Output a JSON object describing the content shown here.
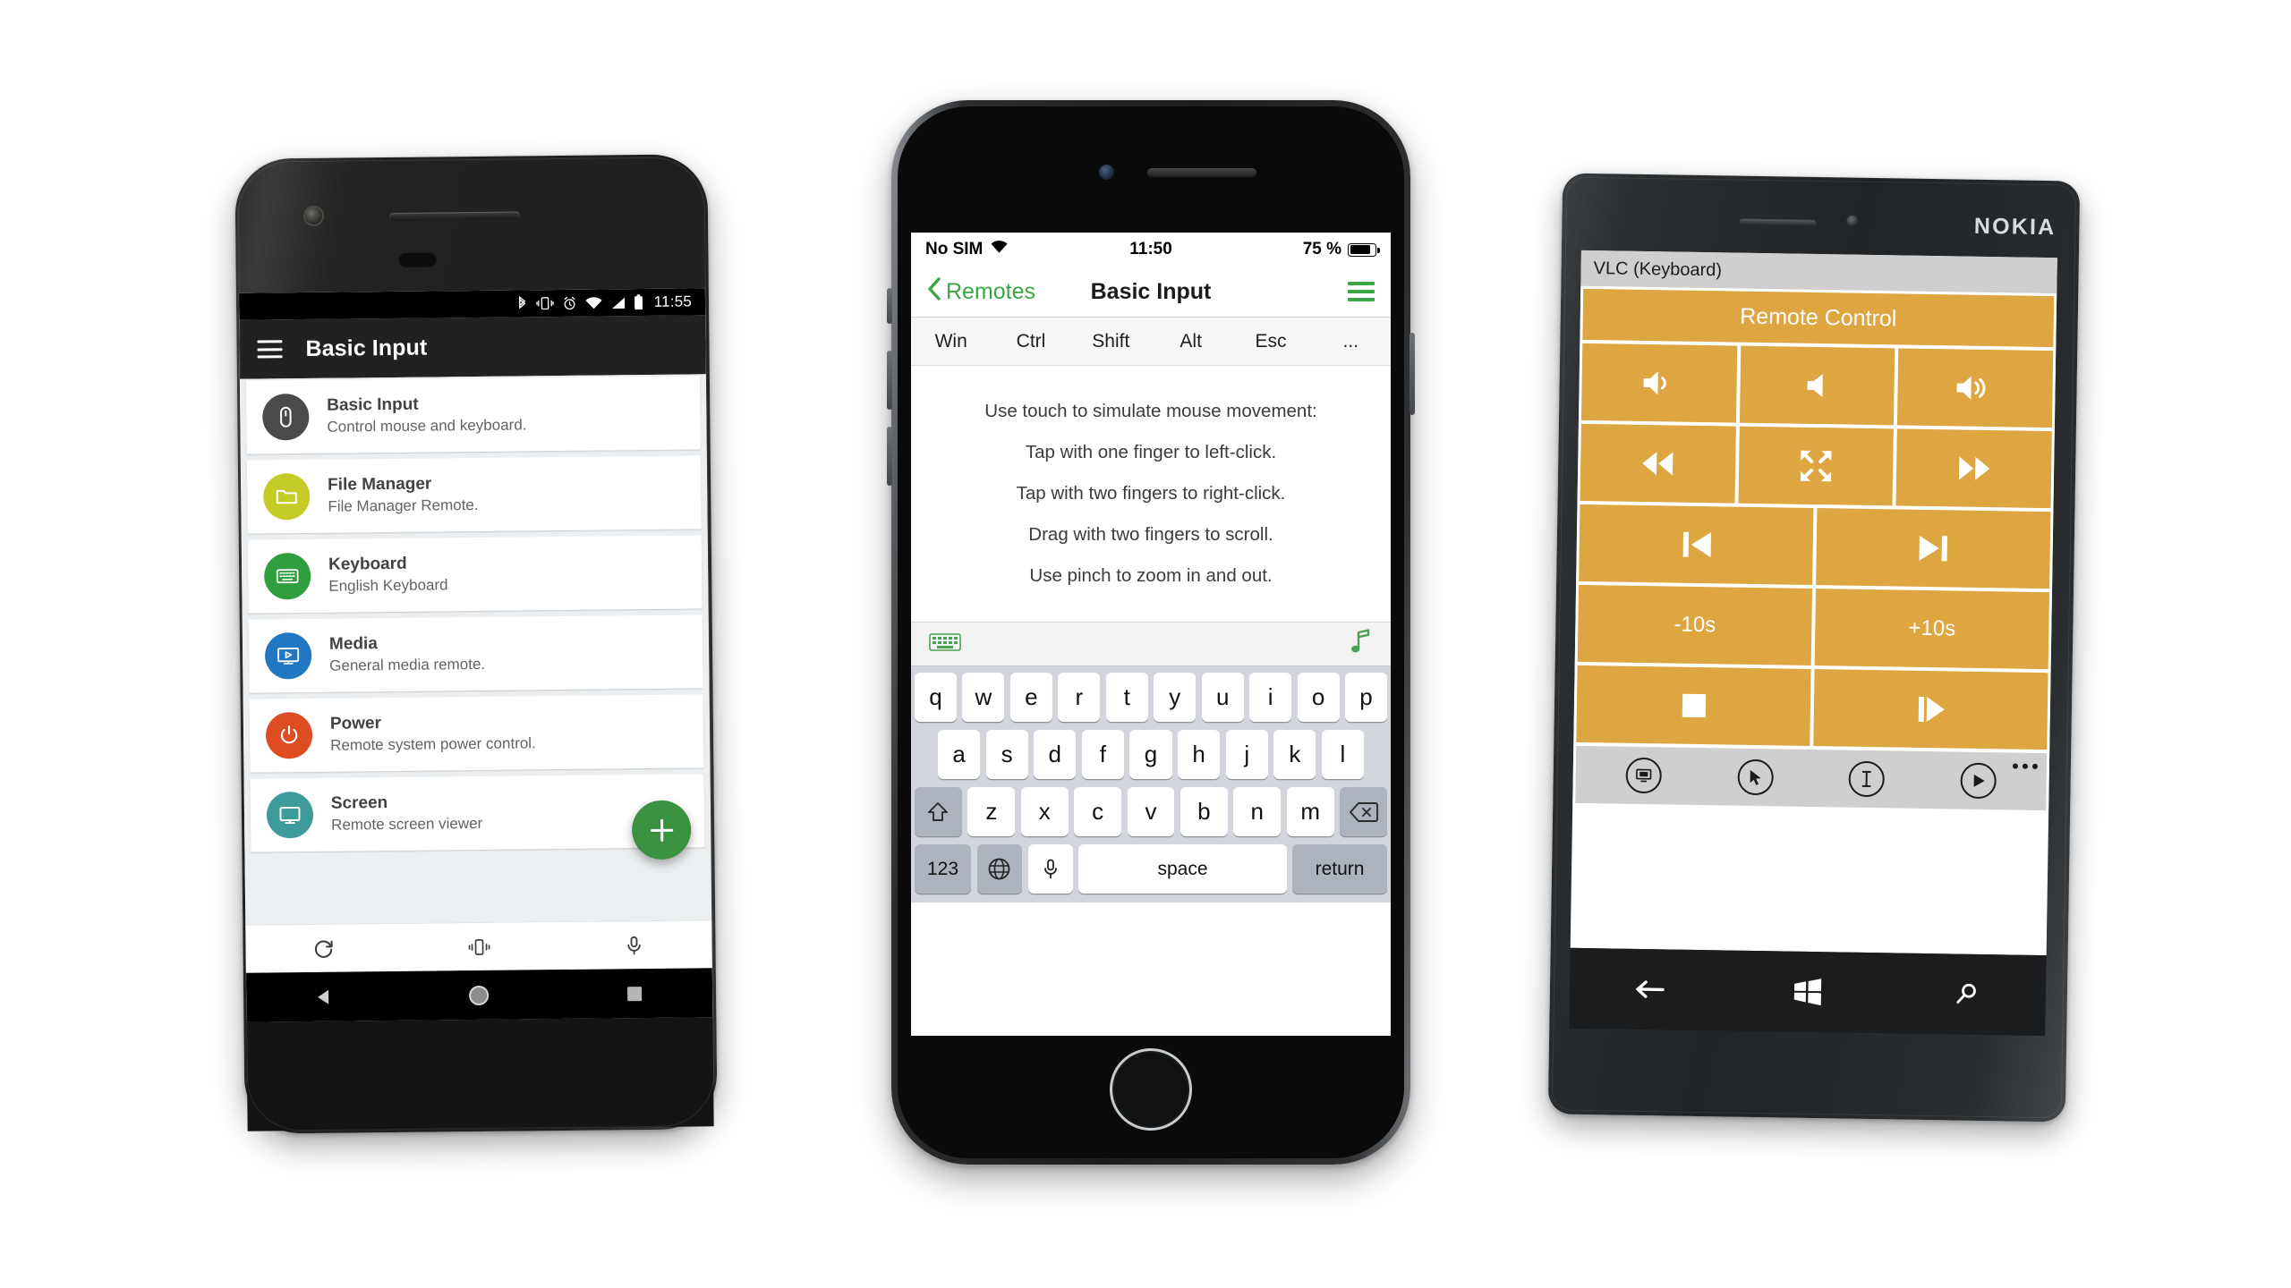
{
  "android": {
    "status_bar": {
      "icons": [
        "bluetooth-icon",
        "vibrate-icon",
        "alarm-icon",
        "wifi-icon",
        "signal-icon",
        "battery-icon"
      ],
      "time": "11:55"
    },
    "app_bar": {
      "menu_icon": "hamburger-menu-icon",
      "title": "Basic Input"
    },
    "list": [
      {
        "title": "Basic Input",
        "subtitle": "Control mouse and keyboard.",
        "icon": "mouse-icon",
        "color": "#4a4a4a"
      },
      {
        "title": "File Manager",
        "subtitle": "File Manager Remote.",
        "icon": "folder-icon",
        "color": "#c5cc28"
      },
      {
        "title": "Keyboard",
        "subtitle": "English Keyboard",
        "icon": "keyboard-icon",
        "color": "#2e9e3e"
      },
      {
        "title": "Media",
        "subtitle": "General media remote.",
        "icon": "media-screen-icon",
        "color": "#2277c2"
      },
      {
        "title": "Power",
        "subtitle": "Remote system power control.",
        "icon": "power-icon",
        "color": "#de4c22"
      },
      {
        "title": "Screen",
        "subtitle": "Remote screen viewer",
        "icon": "monitor-icon",
        "color": "#3e9b9b"
      }
    ],
    "fab": {
      "icon": "plus-icon",
      "color": "#3a913f"
    },
    "bottom_bar": [
      "refresh-icon",
      "vibrate-phone-icon",
      "microphone-icon"
    ],
    "nav_bar": [
      "back-triangle-icon",
      "home-circle-icon",
      "recents-square-icon"
    ]
  },
  "iphone": {
    "status_bar": {
      "carrier": "No SIM",
      "wifi_icon": "wifi-icon",
      "time": "11:50",
      "battery_pct": "75 %",
      "battery_icon": "battery-icon"
    },
    "nav_bar": {
      "back_label": "Remotes",
      "back_icon": "chevron-left-icon",
      "title": "Basic Input",
      "menu_icon": "hamburger-menu-icon",
      "accent": "#3aa745"
    },
    "modifier_keys": [
      "Win",
      "Ctrl",
      "Shift",
      "Alt",
      "Esc",
      "..."
    ],
    "instructions": [
      "Use touch to simulate mouse movement:",
      "Tap with one finger to left-click.",
      "Tap with two fingers to right-click.",
      "Drag with two fingers to scroll.",
      "Use pinch to zoom in and out."
    ],
    "accessory_bar": {
      "left_icon": "keyboard-icon",
      "right_icon": "music-note-icon"
    },
    "keyboard": {
      "row1": [
        "q",
        "w",
        "e",
        "r",
        "t",
        "y",
        "u",
        "i",
        "o",
        "p"
      ],
      "row2": [
        "a",
        "s",
        "d",
        "f",
        "g",
        "h",
        "j",
        "k",
        "l"
      ],
      "row3": [
        "z",
        "x",
        "c",
        "v",
        "b",
        "n",
        "m"
      ],
      "shift_icon": "shift-arrow-icon",
      "backspace_icon": "backspace-icon",
      "num_label": "123",
      "globe_icon": "globe-icon",
      "mic_icon": "microphone-icon",
      "space_label": "space",
      "return_label": "return"
    }
  },
  "nokia": {
    "brand": "NOKIA",
    "title_bar": "VLC (Keyboard)",
    "remote": {
      "header": "Remote Control",
      "accent": "#dda640",
      "buttons": [
        {
          "label": "",
          "icon": "volume-down-icon",
          "span": "third"
        },
        {
          "label": "",
          "icon": "volume-mute-icon",
          "span": "third"
        },
        {
          "label": "",
          "icon": "volume-up-icon",
          "span": "third"
        },
        {
          "label": "",
          "icon": "rewind-icon",
          "span": "third"
        },
        {
          "label": "",
          "icon": "fullscreen-icon",
          "span": "third"
        },
        {
          "label": "",
          "icon": "fast-forward-icon",
          "span": "third"
        },
        {
          "label": "",
          "icon": "previous-track-icon",
          "span": "half"
        },
        {
          "label": "",
          "icon": "next-track-icon",
          "span": "half"
        },
        {
          "label": "-10s",
          "icon": "",
          "span": "half"
        },
        {
          "label": "+10s",
          "icon": "",
          "span": "half"
        },
        {
          "label": "",
          "icon": "stop-icon",
          "span": "half"
        },
        {
          "label": "",
          "icon": "play-icon",
          "span": "half"
        }
      ]
    },
    "app_bar": {
      "icons": [
        "monitor-icon",
        "cursor-arrow-icon",
        "text-cursor-icon",
        "play-circle-icon"
      ],
      "more_icon": "more-dots-icon"
    },
    "nav_bar": [
      "back-arrow-icon",
      "windows-logo-icon",
      "search-icon"
    ]
  }
}
